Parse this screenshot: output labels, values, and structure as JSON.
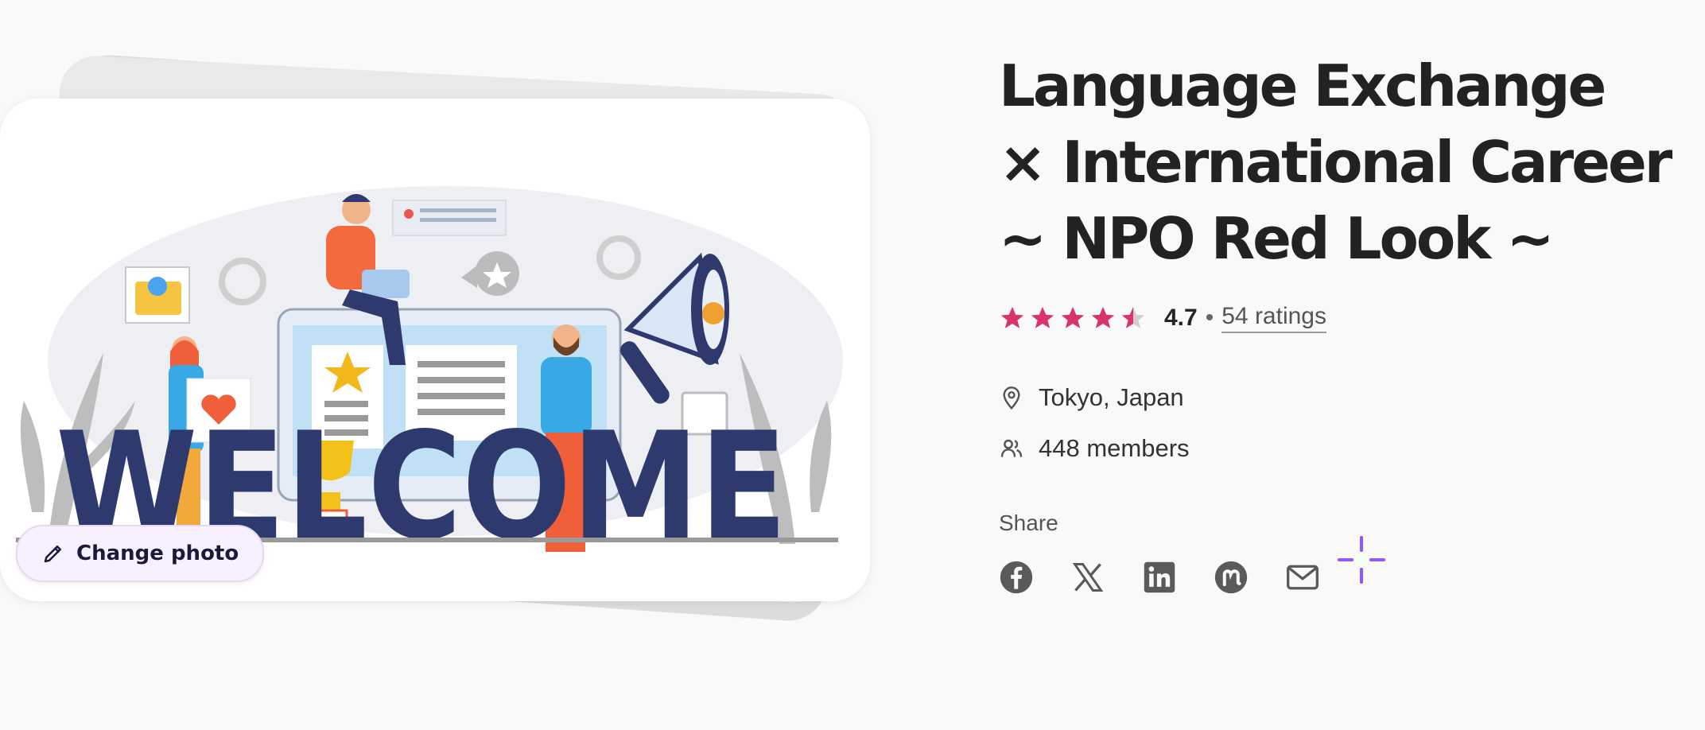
{
  "photo": {
    "welcome_word": "WELCOME",
    "change_photo_label": "Change photo"
  },
  "group": {
    "title": "Language Exchange\n× International Career\n~ NPO Red Look ~",
    "rating_value": "4.7",
    "rating_separator": "•",
    "rating_count": "54 ratings",
    "stars": 4.7,
    "location": "Tokyo, Japan",
    "members": "448 members"
  },
  "share": {
    "label": "Share",
    "icons": [
      "facebook-icon",
      "x-icon",
      "linkedin-icon",
      "meetup-icon",
      "email-icon"
    ]
  },
  "colors": {
    "star": "#d8336a",
    "star_empty": "#cfcfcf",
    "accent_purple": "#8b5cf6",
    "welcome_navy": "#2e3a6e"
  }
}
